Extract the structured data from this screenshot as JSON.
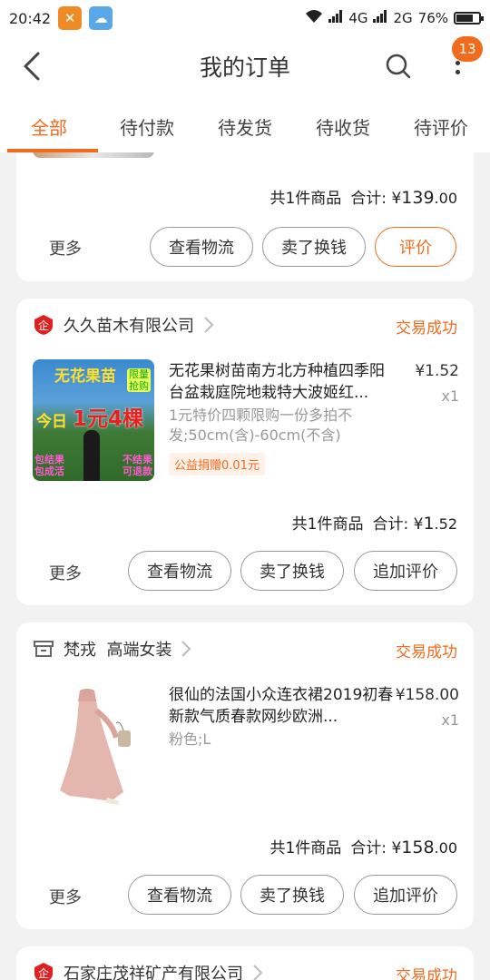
{
  "status_bar": {
    "time": "20:42",
    "network1": "4G",
    "network2": "2G",
    "battery": "76%",
    "battery_level": 0.76
  },
  "header": {
    "title": "我的订单",
    "badge": "13"
  },
  "tabs": [
    {
      "label": "全部"
    },
    {
      "label": "待付款"
    },
    {
      "label": "待发货"
    },
    {
      "label": "待收货"
    },
    {
      "label": "待评价"
    }
  ],
  "orders": [
    {
      "summary": {
        "count_label": "共1件商品",
        "total_label": "合计:",
        "currency": "¥",
        "total_int": "139",
        "total_dec": ".00"
      },
      "actions": {
        "more": "更多",
        "logistics": "查看物流",
        "sell": "卖了换钱",
        "review": "评价"
      }
    },
    {
      "shop": "久久苗木有限公司",
      "status": "交易成功",
      "thumb": {
        "line1": "无花果苗",
        "line2": "今日",
        "line3": "1元4棵",
        "badge": "限量抢购",
        "left_tag": "包结果 包成活",
        "right_tag": "不结果 可退款"
      },
      "title": "无花果树苗南方北方种植四季阳台盆栽庭院地栽特大波姬红...",
      "spec": "1元特价四颗限购一份多拍不发;50cm(含)-60cm(不含)",
      "charity": "公益捐赠0.01元",
      "price": "¥1.52",
      "qty": "x1",
      "summary": {
        "count_label": "共1件商品",
        "total_label": "合计:",
        "currency": "¥",
        "total_int": "1",
        "total_dec": ".52"
      },
      "actions": {
        "more": "更多",
        "logistics": "查看物流",
        "sell": "卖了换钱",
        "review": "追加评价"
      }
    },
    {
      "shop": "梵戎  高端女装",
      "status": "交易成功",
      "title": "很仙的法国小众连衣裙2019初春新款气质春款网纱欧洲...",
      "spec": "粉色;L",
      "price": "¥158.00",
      "qty": "x1",
      "summary": {
        "count_label": "共1件商品",
        "total_label": "合计:",
        "currency": "¥",
        "total_int": "158",
        "total_dec": ".00"
      },
      "actions": {
        "more": "更多",
        "logistics": "查看物流",
        "sell": "卖了换钱",
        "review": "追加评价"
      }
    },
    {
      "shop": "石家庄茂祥矿产有限公司",
      "status": "交易成功"
    }
  ],
  "colors": {
    "accent": "#f26a1b"
  }
}
